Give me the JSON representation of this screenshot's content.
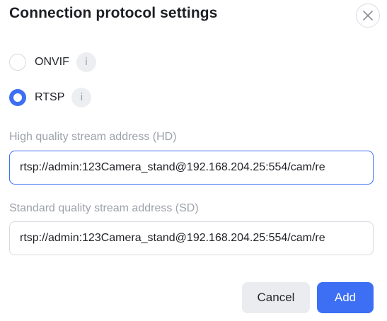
{
  "dialog": {
    "title": "Connection protocol settings",
    "close_icon": "close-icon"
  },
  "protocols": [
    {
      "label": "ONVIF",
      "selected": false,
      "info_icon": "info-icon",
      "info_glyph": "i"
    },
    {
      "label": "RTSP",
      "selected": true,
      "info_icon": "info-icon",
      "info_glyph": "i"
    }
  ],
  "fields": {
    "hd": {
      "label": "High quality stream address (HD)",
      "value": "rtsp://admin:123Camera_stand@192.168.204.25:554/cam/re"
    },
    "sd": {
      "label": "Standard quality stream address (SD)",
      "value": "rtsp://admin:123Camera_stand@192.168.204.25:554/cam/re"
    }
  },
  "buttons": {
    "cancel_label": "Cancel",
    "add_label": "Add"
  },
  "colors": {
    "accent": "#3d6ff5",
    "secondary_button": "#ebecf0",
    "muted_text": "#9ea2aa"
  }
}
